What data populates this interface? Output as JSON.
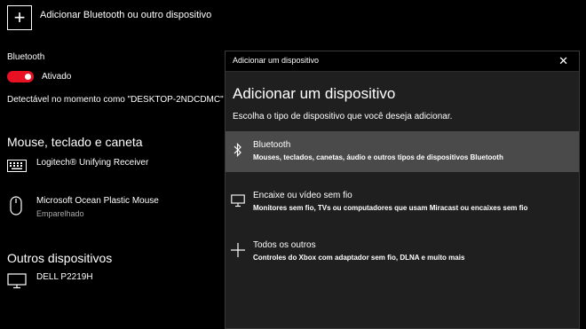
{
  "add_device": {
    "label": "Adicionar Bluetooth ou outro dispositivo"
  },
  "bluetooth": {
    "heading": "Bluetooth",
    "state_label": "Ativado",
    "discoverable_text": "Detectável no momento como \"DESKTOP-2NDCDMC\""
  },
  "mouse_section": {
    "title": "Mouse, teclado e caneta",
    "devices": [
      {
        "name": "Logitech® Unifying Receiver",
        "status": "",
        "icon": "keyboard-icon"
      },
      {
        "name": "Microsoft Ocean Plastic Mouse",
        "status": "Emparelhado",
        "icon": "mouse-icon"
      }
    ]
  },
  "other_section": {
    "title": "Outros dispositivos",
    "devices": [
      {
        "name": "DELL P2219H",
        "icon": "monitor-icon"
      }
    ]
  },
  "dialog": {
    "window_title": "Adicionar um dispositivo",
    "close_icon": "close-icon",
    "heading": "Adicionar um dispositivo",
    "subtitle": "Escolha o tipo de dispositivo que você deseja adicionar.",
    "options": [
      {
        "title": "Bluetooth",
        "description": "Mouses, teclados, canetas, áudio e outros tipos de dispositivos Bluetooth",
        "icon": "bluetooth-icon",
        "selected": true
      },
      {
        "title": "Encaixe ou vídeo sem fio",
        "description": "Monitores sem fio, TVs ou computadores que usam Miracast ou encaixes sem fio",
        "icon": "monitor-icon",
        "selected": false
      },
      {
        "title": "Todos os outros",
        "description": "Controles do Xbox com adaptador sem fio, DLNA e muito mais",
        "icon": "plus-icon",
        "selected": false
      }
    ]
  },
  "colors": {
    "toggle_on": "#e81123",
    "selected_option": "#4a4a4a",
    "dialog_bg": "#1f1f1f"
  }
}
